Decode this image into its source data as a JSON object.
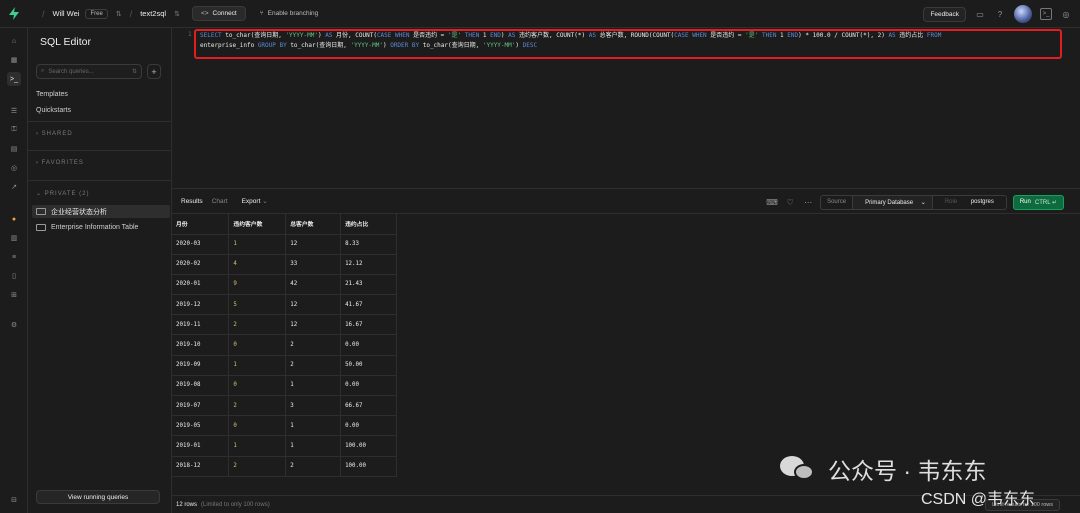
{
  "topbar": {
    "user": "Will Wei",
    "plan_badge": "Free",
    "project": "text2sql",
    "connect_label": "Connect",
    "branching_label": "Enable branching",
    "feedback_label": "Feedback"
  },
  "sidebar": {
    "title": "SQL Editor",
    "search_placeholder": "Search queries...",
    "links": [
      "Templates",
      "Quickstarts"
    ],
    "section_shared": "SHARED",
    "section_favorites": "FAVORITES",
    "section_private": "PRIVATE (2)",
    "items": [
      "企业经营状态分析",
      "Enterprise Information Table"
    ],
    "bottom_button": "View running queries"
  },
  "editor": {
    "line_number": "1",
    "line1_parts": [
      {
        "t": "SELECT",
        "k": "kw"
      },
      {
        "t": " to_char(查询日期, ",
        "k": ""
      },
      {
        "t": "'YYYY-MM'",
        "k": "str"
      },
      {
        "t": ") ",
        "k": ""
      },
      {
        "t": "AS",
        "k": "kw"
      },
      {
        "t": " 月份, COUNT(",
        "k": ""
      },
      {
        "t": "CASE WHEN",
        "k": "kw"
      },
      {
        "t": " 是否违约 = ",
        "k": ""
      },
      {
        "t": "'是'",
        "k": "str"
      },
      {
        "t": " ",
        "k": ""
      },
      {
        "t": "THEN",
        "k": "kw"
      },
      {
        "t": " 1 ",
        "k": ""
      },
      {
        "t": "END",
        "k": "kw"
      },
      {
        "t": ") ",
        "k": ""
      },
      {
        "t": "AS",
        "k": "kw"
      },
      {
        "t": " 违约客户数, COUNT(*) ",
        "k": ""
      },
      {
        "t": "AS",
        "k": "kw"
      },
      {
        "t": " 总客户数, ROUND(COUNT(",
        "k": ""
      },
      {
        "t": "CASE WHEN",
        "k": "kw"
      },
      {
        "t": " 是否违约 = ",
        "k": ""
      },
      {
        "t": "'是'",
        "k": "str"
      },
      {
        "t": " ",
        "k": ""
      },
      {
        "t": "THEN",
        "k": "kw"
      },
      {
        "t": " 1 ",
        "k": ""
      },
      {
        "t": "END",
        "k": "kw"
      },
      {
        "t": ") * 100.0 / COUNT(*), 2) ",
        "k": ""
      },
      {
        "t": "AS",
        "k": "kw"
      },
      {
        "t": " 违约占比 ",
        "k": ""
      },
      {
        "t": "FROM",
        "k": "kw"
      }
    ],
    "line2_parts": [
      {
        "t": "enterprise_info ",
        "k": ""
      },
      {
        "t": "GROUP BY",
        "k": "kw"
      },
      {
        "t": " to_char(查询日期, ",
        "k": ""
      },
      {
        "t": "'YYYY-MM'",
        "k": "str"
      },
      {
        "t": ") ",
        "k": ""
      },
      {
        "t": "ORDER BY",
        "k": "kw"
      },
      {
        "t": " to_char(查询日期, ",
        "k": ""
      },
      {
        "t": "'YYYY-MM'",
        "k": "str"
      },
      {
        "t": ") ",
        "k": ""
      },
      {
        "t": "DESC",
        "k": "kw"
      }
    ]
  },
  "results_toolbar": {
    "tabs": [
      "Results",
      "Chart"
    ],
    "export_label": "Export",
    "source_label": "Source",
    "database_label": "Primary Database",
    "role_label": "postgres",
    "run_label": "Run",
    "run_shortcut": "CTRL ↵"
  },
  "table": {
    "columns": [
      "月份",
      "违约客户数",
      "总客户数",
      "违约占比"
    ],
    "rows": [
      [
        "2020-03",
        "1",
        "12",
        "8.33"
      ],
      [
        "2020-02",
        "4",
        "33",
        "12.12"
      ],
      [
        "2020-01",
        "9",
        "42",
        "21.43"
      ],
      [
        "2019-12",
        "5",
        "12",
        "41.67"
      ],
      [
        "2019-11",
        "2",
        "12",
        "16.67"
      ],
      [
        "2019-10",
        "0",
        "2",
        "0.00"
      ],
      [
        "2019-09",
        "1",
        "2",
        "50.00"
      ],
      [
        "2019-08",
        "0",
        "1",
        "0.00"
      ],
      [
        "2019-07",
        "2",
        "3",
        "66.67"
      ],
      [
        "2019-05",
        "0",
        "1",
        "0.00"
      ],
      [
        "2019-01",
        "1",
        "1",
        "100.00"
      ],
      [
        "2018-12",
        "2",
        "2",
        "100.00"
      ]
    ]
  },
  "statusbar": {
    "rows_count": "12 rows",
    "rows_note": "(Limited to only 100 rows)",
    "limit_label": "Limit results to: 100 rows"
  },
  "watermark": {
    "text": "公众号 · 韦东东",
    "csdn": "CSDN @韦东东"
  }
}
